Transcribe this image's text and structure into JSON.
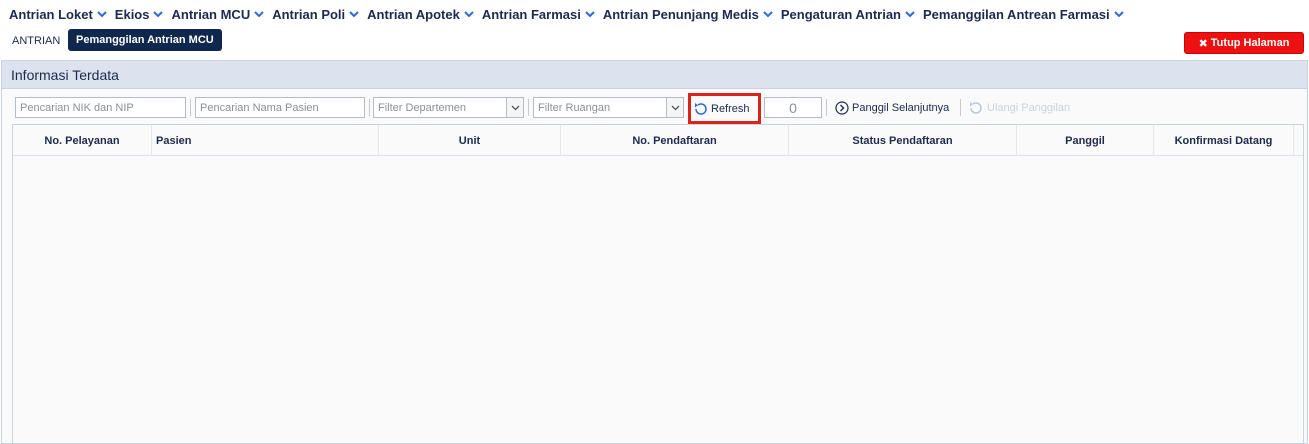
{
  "menu": {
    "items": [
      {
        "label": "Antrian Loket"
      },
      {
        "label": "Ekios"
      },
      {
        "label": "Antrian MCU"
      },
      {
        "label": "Antrian Poli"
      },
      {
        "label": "Antrian Apotek"
      },
      {
        "label": "Antrian Farmasi"
      },
      {
        "label": "Antrian Penunjang Medis"
      },
      {
        "label": "Pengaturan Antrian"
      },
      {
        "label": "Pemanggilan Antrean Farmasi"
      }
    ],
    "chevron_icon": "chevron-down-icon"
  },
  "tabs": {
    "plain_label": "ANTRIAN",
    "active_label": "Pemanggilan Antrian MCU"
  },
  "close_button": {
    "label": "Tutup Halaman",
    "icon": "close-icon",
    "color": "#ee1111"
  },
  "panel": {
    "title": "Informasi Terdata"
  },
  "toolbar": {
    "nik_placeholder": "Pencarian NIK dan NIP",
    "name_placeholder": "Pencarian Nama Pasien",
    "department_placeholder": "Filter Departemen",
    "room_placeholder": "Filter Ruangan",
    "refresh_label": "Refresh",
    "counter_value": "0",
    "next_label": "Panggil Selanjutnya",
    "repeat_label": "Ulangi Panggilan",
    "highlight_color": "#d9241c"
  },
  "table": {
    "columns": [
      "No. Pelayanan",
      "Pasien",
      "Unit",
      "No. Pendaftaran",
      "Status Pendaftaran",
      "Panggil",
      "Konfirmasi Datang"
    ],
    "rows": []
  },
  "colors": {
    "brand_dark": "#10284d",
    "header_bg": "#dde3ee",
    "danger": "#ee1111"
  }
}
